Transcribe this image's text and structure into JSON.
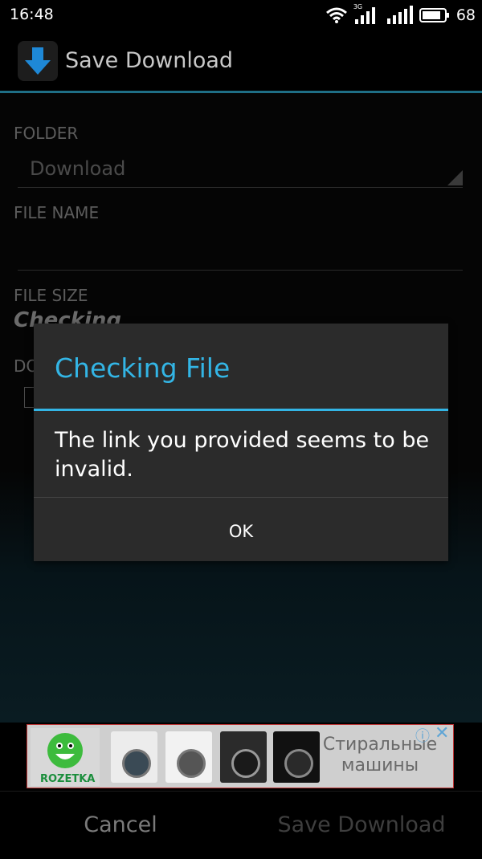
{
  "status_bar": {
    "time": "16:48",
    "network": "3G",
    "battery": "68"
  },
  "app_bar": {
    "title": "Save Download"
  },
  "form": {
    "folder_label": "FOLDER",
    "folder_value": "Download",
    "file_name_label": "FILE NAME",
    "file_size_label": "FILE SIZE",
    "file_size_value": "Checking",
    "partial_label": "DO"
  },
  "dialog": {
    "title": "Checking File",
    "message": "The link you provided seems to be invalid.",
    "ok_label": "OK"
  },
  "ad": {
    "brand": "ROZETKA",
    "line1": "Стиральные",
    "line2": "машины"
  },
  "bottom_buttons": {
    "cancel_label": "Cancel",
    "save_label": "Save Download"
  },
  "colors": {
    "accent": "#33b5e5",
    "dialog_bg": "#2b2b2b",
    "divider": "#1f6f86"
  }
}
